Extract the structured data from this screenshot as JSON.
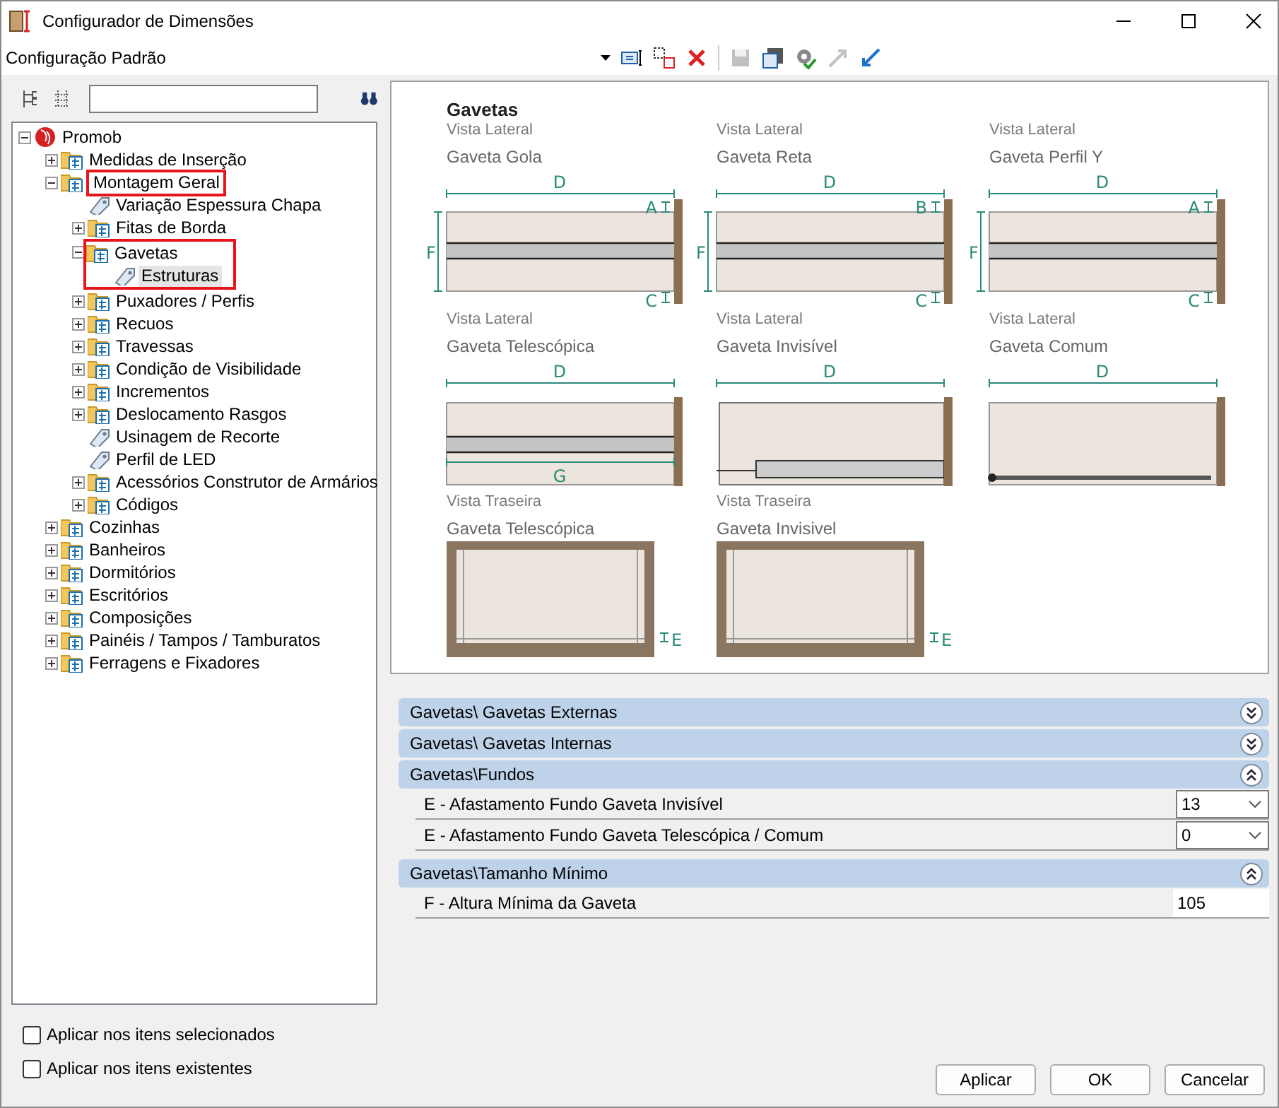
{
  "window": {
    "title": "Configurador de Dimensões"
  },
  "config": {
    "name": "Configuração Padrão"
  },
  "toolbar": [
    {
      "disabled": false
    },
    {
      "disabled": false
    },
    {
      "disabled": false
    },
    {
      "disabled": true
    },
    {
      "disabled": false
    },
    {
      "disabled": false
    },
    {
      "disabled": true
    },
    {
      "disabled": false
    }
  ],
  "tree": [
    {
      "label": "Promob",
      "kind": "root",
      "expanded": true,
      "selected": false,
      "children": [
        {
          "label": "Medidas de Inserção",
          "kind": "folder",
          "expanded": false,
          "selected": false
        },
        {
          "label": "Montagem Geral",
          "kind": "folder",
          "expanded": true,
          "selected": false,
          "highlighted": true,
          "children": [
            {
              "label": "Variação Espessura Chapa",
              "kind": "tag",
              "selected": false
            },
            {
              "label": "Fitas de Borda",
              "kind": "folder",
              "expanded": false,
              "selected": false
            },
            {
              "label": "Gavetas",
              "kind": "folder",
              "expanded": true,
              "selected": false,
              "highlighted": true,
              "highlight_includes_children": true,
              "children": [
                {
                  "label": "Estruturas",
                  "kind": "tag",
                  "selected": true
                }
              ]
            },
            {
              "label": "Puxadores / Perfis",
              "kind": "folder",
              "expanded": false,
              "selected": false
            },
            {
              "label": "Recuos",
              "kind": "folder",
              "expanded": false,
              "selected": false
            },
            {
              "label": "Travessas",
              "kind": "folder",
              "expanded": false,
              "selected": false
            },
            {
              "label": "Condição de Visibilidade",
              "kind": "folder",
              "expanded": false,
              "selected": false
            },
            {
              "label": "Incrementos",
              "kind": "folder",
              "expanded": false,
              "selected": false
            },
            {
              "label": "Deslocamento Rasgos",
              "kind": "folder",
              "expanded": false,
              "selected": false
            },
            {
              "label": "Usinagem de Recorte",
              "kind": "tag",
              "selected": false
            },
            {
              "label": "Perfil de LED",
              "kind": "tag",
              "selected": false
            },
            {
              "label": "Acessórios Construtor de Armários",
              "kind": "folder",
              "expanded": false,
              "selected": false
            },
            {
              "label": "Códigos",
              "kind": "folder",
              "expanded": false,
              "selected": false
            }
          ]
        },
        {
          "label": "Cozinhas",
          "kind": "folder",
          "expanded": false,
          "selected": false
        },
        {
          "label": "Banheiros",
          "kind": "folder",
          "expanded": false,
          "selected": false
        },
        {
          "label": "Dormitórios",
          "kind": "folder",
          "expanded": false,
          "selected": false
        },
        {
          "label": "Escritórios",
          "kind": "folder",
          "expanded": false,
          "selected": false
        },
        {
          "label": "Composições",
          "kind": "folder",
          "expanded": false,
          "selected": false
        },
        {
          "label": "Painéis / Tampos / Tamburatos",
          "kind": "folder",
          "expanded": false,
          "selected": false
        },
        {
          "label": "Ferragens e Fixadores",
          "kind": "folder",
          "expanded": false,
          "selected": false
        }
      ]
    }
  ],
  "picture": {
    "title": "Gavetas",
    "diagrams": [
      {
        "view": "Vista Lateral",
        "name": "Gaveta Gola",
        "kind": "side-rail",
        "dims": {
          "width": "D",
          "top": "A",
          "height": "F",
          "bottom": "C"
        }
      },
      {
        "view": "Vista Lateral",
        "name": "Gaveta Reta",
        "kind": "side-rail",
        "dims": {
          "width": "D",
          "top": "B",
          "height": "F",
          "bottom": "C"
        }
      },
      {
        "view": "Vista Lateral",
        "name": "Gaveta Perfil Y",
        "kind": "side-rail",
        "dims": {
          "width": "D",
          "top": "A",
          "height": "F",
          "bottom": "C"
        }
      },
      {
        "view": "Vista Lateral",
        "name": "Gaveta Telescópica",
        "kind": "side-telescopic",
        "dims": {
          "width": "D",
          "rail": "G"
        }
      },
      {
        "view": "Vista Lateral",
        "name": "Gaveta Invisível",
        "kind": "side-invisible",
        "dims": {
          "width": "D"
        }
      },
      {
        "view": "Vista Lateral",
        "name": "Gaveta Comum",
        "kind": "side-common",
        "dims": {
          "width": "D"
        }
      },
      {
        "view": "Vista Traseira",
        "name": "Gaveta Telescópica",
        "kind": "back",
        "dims": {
          "gap": "E"
        }
      },
      {
        "view": "Vista Traseira",
        "name": "Gaveta Invisivel",
        "kind": "back",
        "dims": {
          "gap": "E"
        }
      }
    ]
  },
  "sections": [
    {
      "title": "Gavetas\\ Gavetas Externas",
      "expanded": false
    },
    {
      "title": "Gavetas\\ Gavetas Internas",
      "expanded": false
    },
    {
      "title": "Gavetas\\Fundos",
      "expanded": true,
      "properties": [
        {
          "label": "E - Afastamento Fundo Gaveta Invisível",
          "value": "13",
          "kind": "dropdown"
        },
        {
          "label": "E - Afastamento Fundo Gaveta Telescópica / Comum",
          "value": "0",
          "kind": "dropdown"
        }
      ]
    },
    {
      "title": "Gavetas\\Tamanho Mínimo",
      "expanded": true,
      "properties": [
        {
          "label": "F - Altura Mínima da Gaveta",
          "value": "105",
          "kind": "text"
        }
      ]
    }
  ],
  "options": [
    {
      "label": "Aplicar nos itens selecionados",
      "checked": false
    },
    {
      "label": "Aplicar nos itens existentes",
      "checked": false
    }
  ],
  "buttons": [
    "Aplicar",
    "OK",
    "Cancelar"
  ]
}
